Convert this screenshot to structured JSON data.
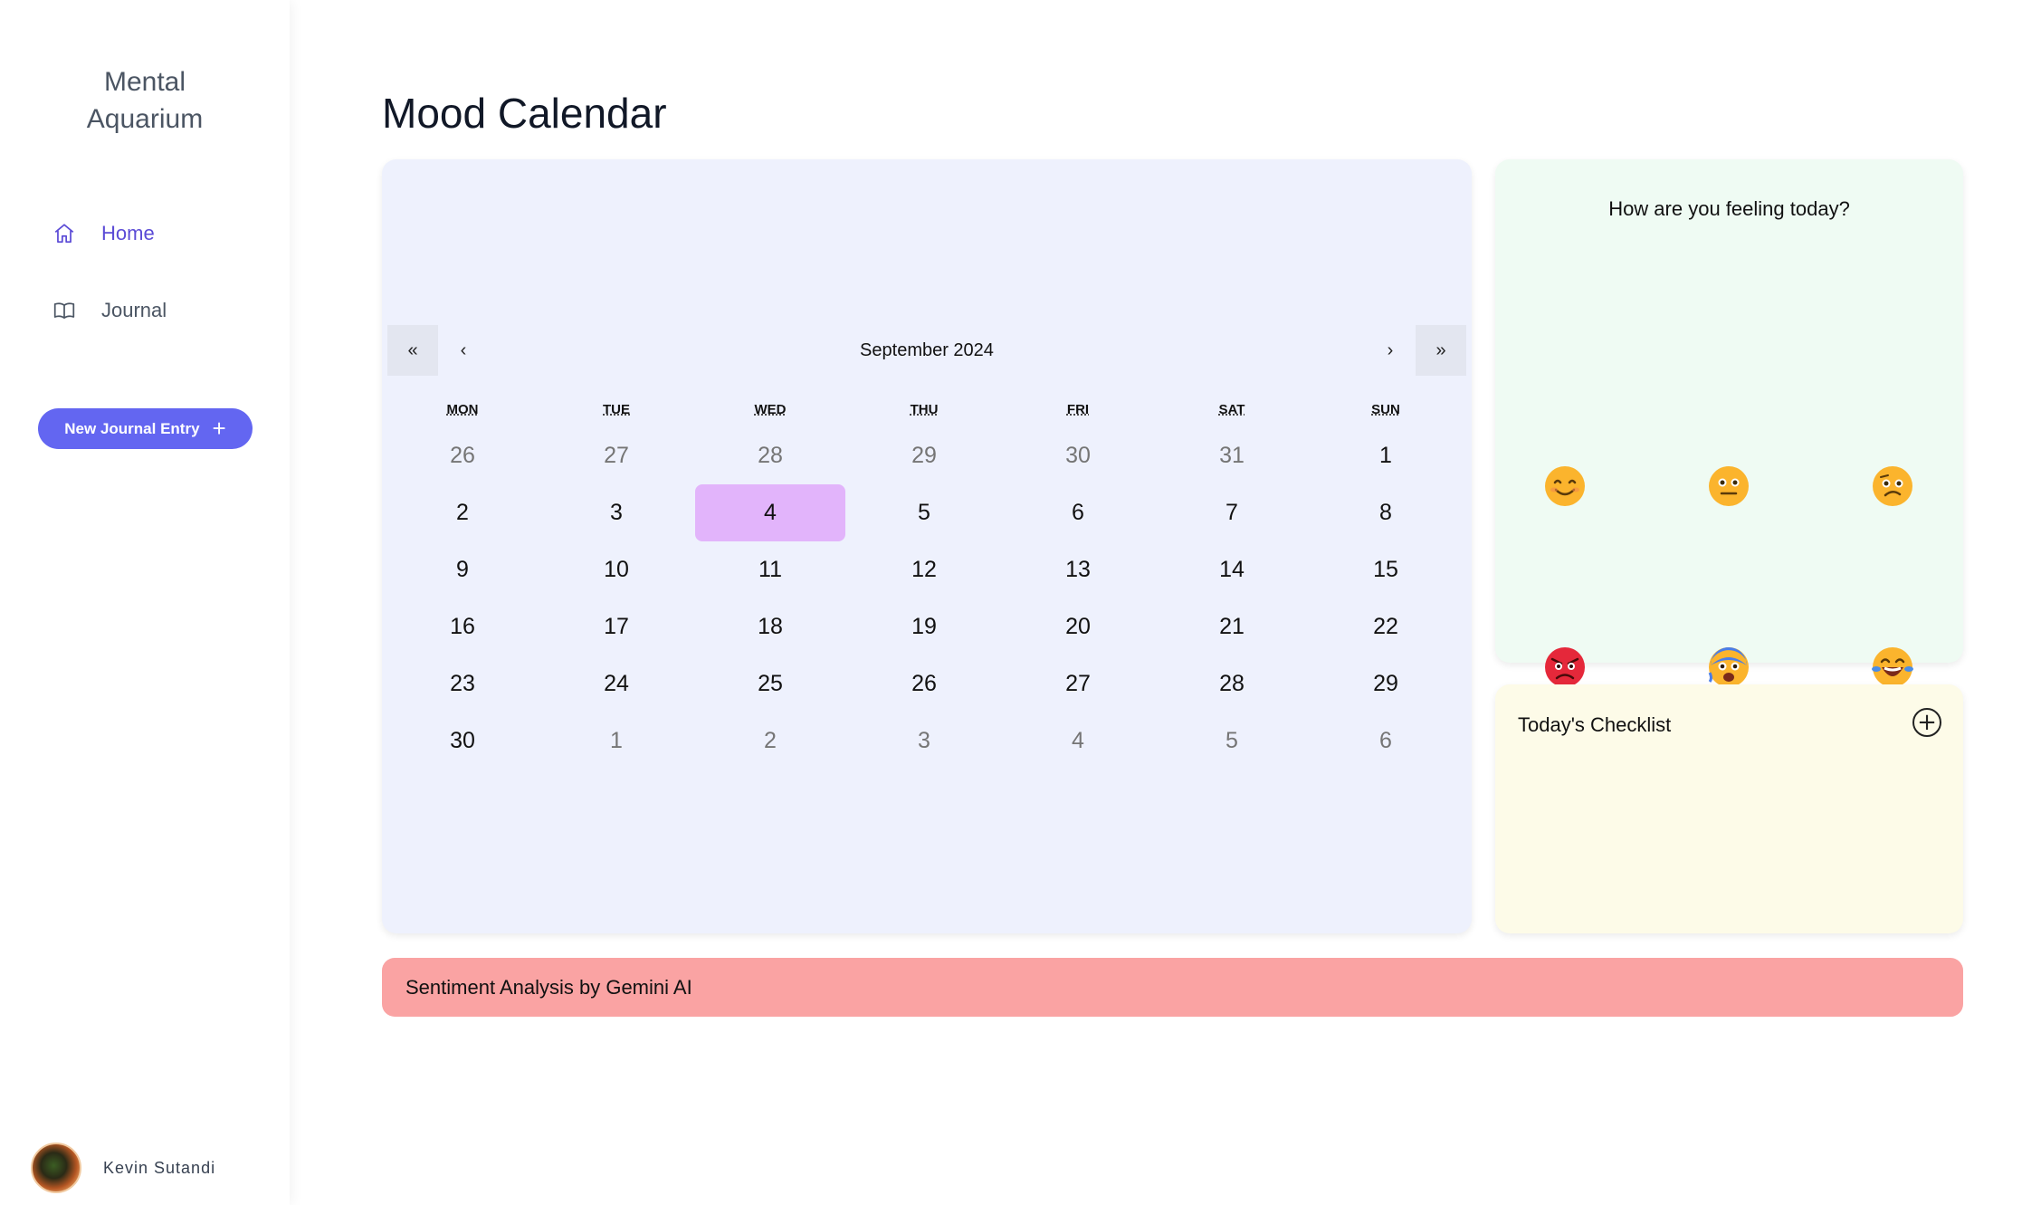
{
  "sidebar": {
    "brand_line1": "Mental",
    "brand_line2": "Aquarium",
    "nav": [
      {
        "label": "Home",
        "icon": "home-icon",
        "active": true
      },
      {
        "label": "Journal",
        "icon": "book-icon",
        "active": false
      }
    ],
    "new_entry_label": "New Journal Entry",
    "user_name": "Kevin Sutandi"
  },
  "main": {
    "title": "Mood Calendar"
  },
  "calendar": {
    "prev2": "«",
    "prev": "‹",
    "next": "›",
    "next2": "»",
    "month_label": "September 2024",
    "weekdays": [
      "MON",
      "TUE",
      "WED",
      "THU",
      "FRI",
      "SAT",
      "SUN"
    ],
    "days": [
      {
        "d": "26",
        "other": true
      },
      {
        "d": "27",
        "other": true
      },
      {
        "d": "28",
        "other": true
      },
      {
        "d": "29",
        "other": true
      },
      {
        "d": "30",
        "other": true
      },
      {
        "d": "31",
        "other": true
      },
      {
        "d": "1"
      },
      {
        "d": "2"
      },
      {
        "d": "3"
      },
      {
        "d": "4",
        "today": true
      },
      {
        "d": "5"
      },
      {
        "d": "6"
      },
      {
        "d": "7"
      },
      {
        "d": "8"
      },
      {
        "d": "9"
      },
      {
        "d": "10"
      },
      {
        "d": "11"
      },
      {
        "d": "12"
      },
      {
        "d": "13"
      },
      {
        "d": "14"
      },
      {
        "d": "15"
      },
      {
        "d": "16"
      },
      {
        "d": "17"
      },
      {
        "d": "18"
      },
      {
        "d": "19"
      },
      {
        "d": "20"
      },
      {
        "d": "21"
      },
      {
        "d": "22"
      },
      {
        "d": "23"
      },
      {
        "d": "24"
      },
      {
        "d": "25"
      },
      {
        "d": "26"
      },
      {
        "d": "27"
      },
      {
        "d": "28"
      },
      {
        "d": "29"
      },
      {
        "d": "30"
      },
      {
        "d": "1",
        "other": true
      },
      {
        "d": "2",
        "other": true
      },
      {
        "d": "3",
        "other": true
      },
      {
        "d": "4",
        "other": true
      },
      {
        "d": "5",
        "other": true
      },
      {
        "d": "6",
        "other": true
      }
    ],
    "today_color": "#e2b4fb",
    "background": "#eef1fd"
  },
  "mood": {
    "title": "How are you feeling today?",
    "emojis": [
      "smiling-face-icon",
      "neutral-face-icon",
      "confused-face-icon",
      "angry-face-icon",
      "anxious-face-icon",
      "laughing-face-icon"
    ]
  },
  "checklist": {
    "title": "Today's Checklist",
    "add_label": "+"
  },
  "sentiment": {
    "label": "Sentiment Analysis by Gemini AI"
  },
  "colors": {
    "accent": "#6366f1",
    "mood_bg": "#effbf3",
    "checklist_bg": "#fdfbe8",
    "sentiment_bg": "#faa3a3"
  }
}
